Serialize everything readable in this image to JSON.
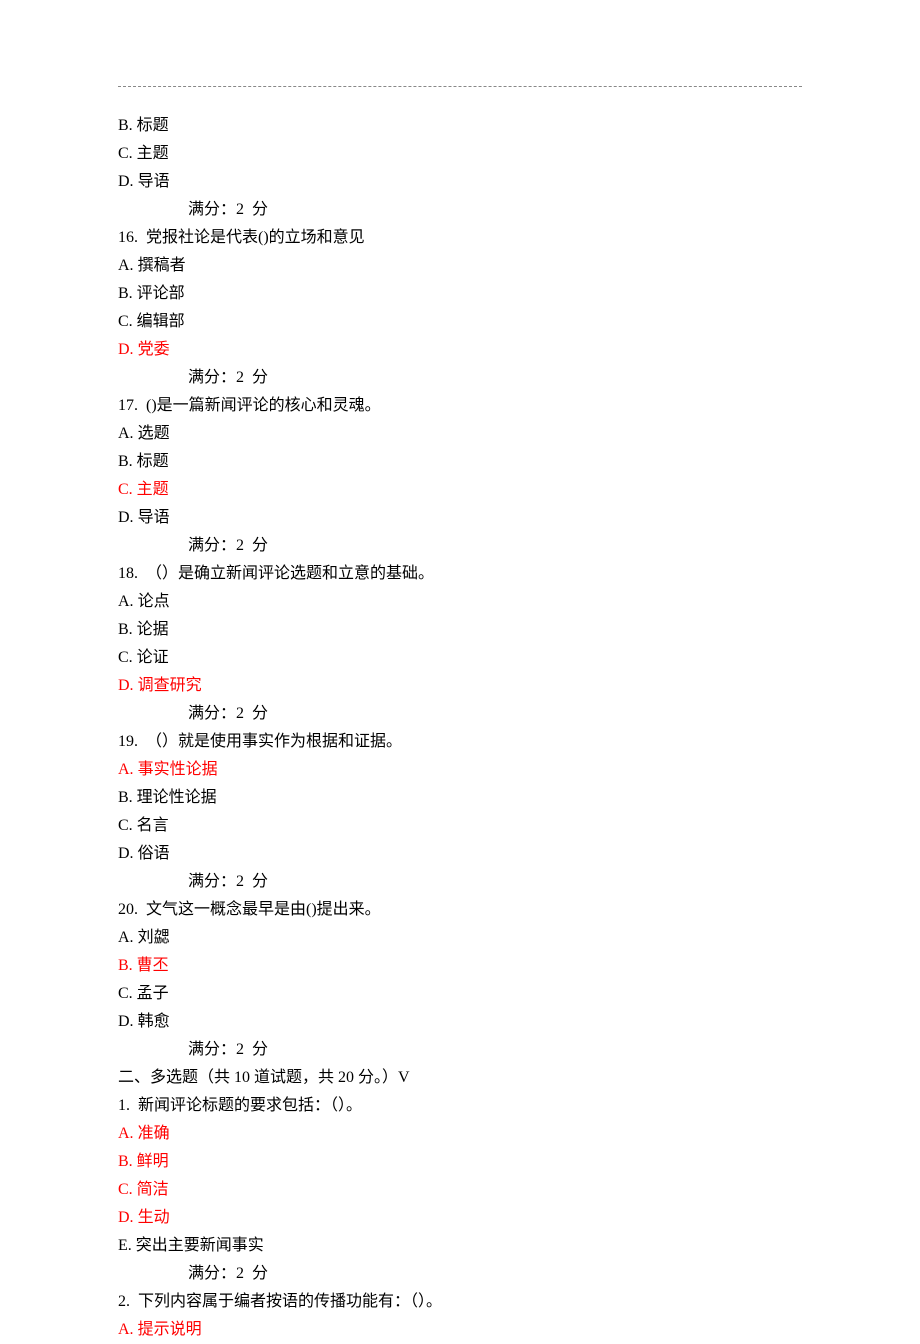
{
  "score_label": "满分：2  分",
  "q15_partial": {
    "options": [
      {
        "label": "B.",
        "text": "标题",
        "red": false
      },
      {
        "label": "C.",
        "text": "主题",
        "red": false
      },
      {
        "label": "D.",
        "text": "导语",
        "red": false
      }
    ]
  },
  "q16": {
    "number": "16.",
    "stem": "  党报社论是代表()的立场和意见",
    "options": [
      {
        "label": "A.",
        "text": "撰稿者",
        "red": false
      },
      {
        "label": "B.",
        "text": "评论部",
        "red": false
      },
      {
        "label": "C.",
        "text": "编辑部",
        "red": false
      },
      {
        "label": "D.",
        "text": "党委",
        "red": true
      }
    ]
  },
  "q17": {
    "number": "17.",
    "stem": "  ()是一篇新闻评论的核心和灵魂。",
    "options": [
      {
        "label": "A.",
        "text": "选题",
        "red": false
      },
      {
        "label": "B.",
        "text": "标题",
        "red": false
      },
      {
        "label": "C.",
        "text": "主题",
        "red": true
      },
      {
        "label": "D.",
        "text": "导语",
        "red": false
      }
    ]
  },
  "q18": {
    "number": "18.",
    "stem": "  （）是确立新闻评论选题和立意的基础。",
    "options": [
      {
        "label": "A.",
        "text": "论点",
        "red": false
      },
      {
        "label": "B.",
        "text": "论据",
        "red": false
      },
      {
        "label": "C.",
        "text": "论证",
        "red": false
      },
      {
        "label": "D.",
        "text": "调查研究",
        "red": true
      }
    ]
  },
  "q19": {
    "number": "19.",
    "stem": "  （）就是使用事实作为根据和证据。",
    "options": [
      {
        "label": "A.",
        "text": "事实性论据",
        "red": true
      },
      {
        "label": "B.",
        "text": "理论性论据",
        "red": false
      },
      {
        "label": "C.",
        "text": "名言",
        "red": false
      },
      {
        "label": "D.",
        "text": "俗语",
        "red": false
      }
    ]
  },
  "q20": {
    "number": "20.",
    "stem": "  文气这一概念最早是由()提出来。",
    "options": [
      {
        "label": "A.",
        "text": "刘勰",
        "red": false
      },
      {
        "label": "B.",
        "text": "曹丕",
        "red": true
      },
      {
        "label": "C.",
        "text": "孟子",
        "red": false
      },
      {
        "label": "D.",
        "text": "韩愈",
        "red": false
      }
    ]
  },
  "section2_header": "二、多选题（共 10 道试题，共 20 分。）V",
  "mq1": {
    "number": "1.",
    "stem": "  新闻评论标题的要求包括：（）。",
    "options": [
      {
        "label": "A.",
        "text": "准确",
        "red": true
      },
      {
        "label": "B.",
        "text": "鲜明",
        "red": true
      },
      {
        "label": "C.",
        "text": "简洁",
        "red": true
      },
      {
        "label": "D.",
        "text": "生动",
        "red": true
      },
      {
        "label": "E.",
        "text": "突出主要新闻事实",
        "red": false
      }
    ]
  },
  "mq2": {
    "number": "2.",
    "stem": "  下列内容属于编者按语的传播功能有：（）。",
    "options_partial": [
      {
        "label": "A.",
        "text": "提示说明",
        "red": true
      }
    ]
  }
}
